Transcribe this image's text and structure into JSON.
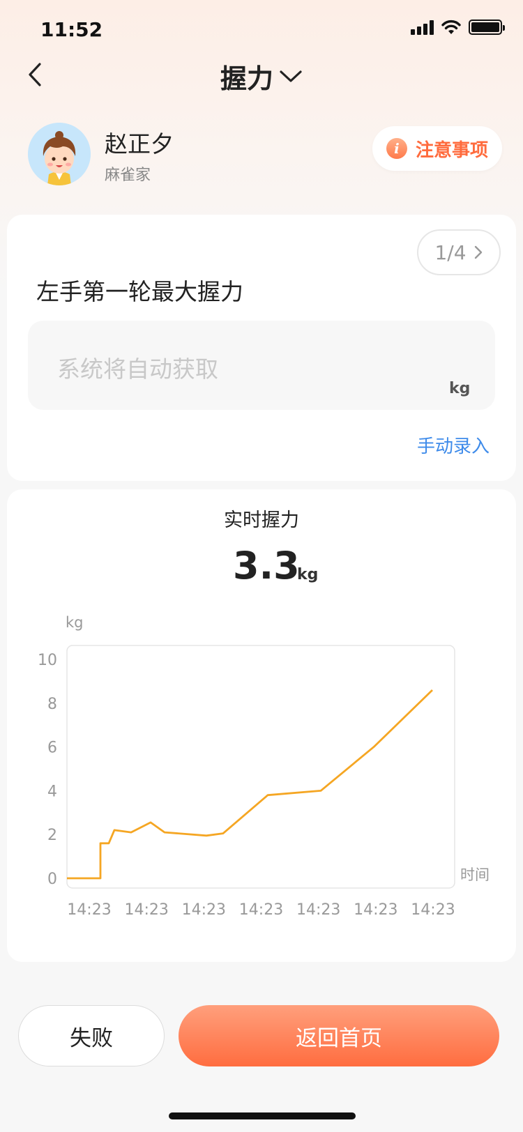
{
  "status_bar": {
    "time": "11:52"
  },
  "nav": {
    "title": "握力"
  },
  "user": {
    "name": "赵正夕",
    "org": "麻雀家"
  },
  "notice": {
    "label": "注意事项"
  },
  "test_card": {
    "page_indicator": "1/4",
    "title": "左手第一轮最大握力",
    "input_placeholder": "系统将自动获取",
    "unit": "kg",
    "manual_link": "手动录入"
  },
  "realtime": {
    "title": "实时握力",
    "value": "3.3",
    "unit": "kg"
  },
  "chart_data": {
    "type": "line",
    "ylabel": "kg",
    "xlabel": "时间",
    "ylim": [
      0,
      10
    ],
    "yticks": [
      0,
      2,
      4,
      6,
      8,
      10
    ],
    "xticks": [
      "14:23",
      "14:23",
      "14:23",
      "14:23",
      "14:23",
      "14:23",
      "14:23"
    ],
    "xlim": [
      0,
      6.8
    ],
    "grid": false,
    "colors": {
      "line": "#f5a623",
      "frame": "#e5e5e5",
      "tick_text": "#999999"
    },
    "series": [
      {
        "x": [
          0,
          0.6,
          0.6,
          0.75,
          0.85,
          1.15,
          1.5,
          1.75,
          2.5,
          2.8,
          3.6,
          4.55,
          5.5,
          6.55
        ],
        "y": [
          0,
          0,
          1.6,
          1.6,
          2.2,
          2.1,
          2.55,
          2.1,
          1.95,
          2.05,
          3.8,
          4.0,
          6.0,
          8.6
        ]
      }
    ]
  },
  "actions": {
    "fail_label": "失败",
    "home_label": "返回首页"
  }
}
